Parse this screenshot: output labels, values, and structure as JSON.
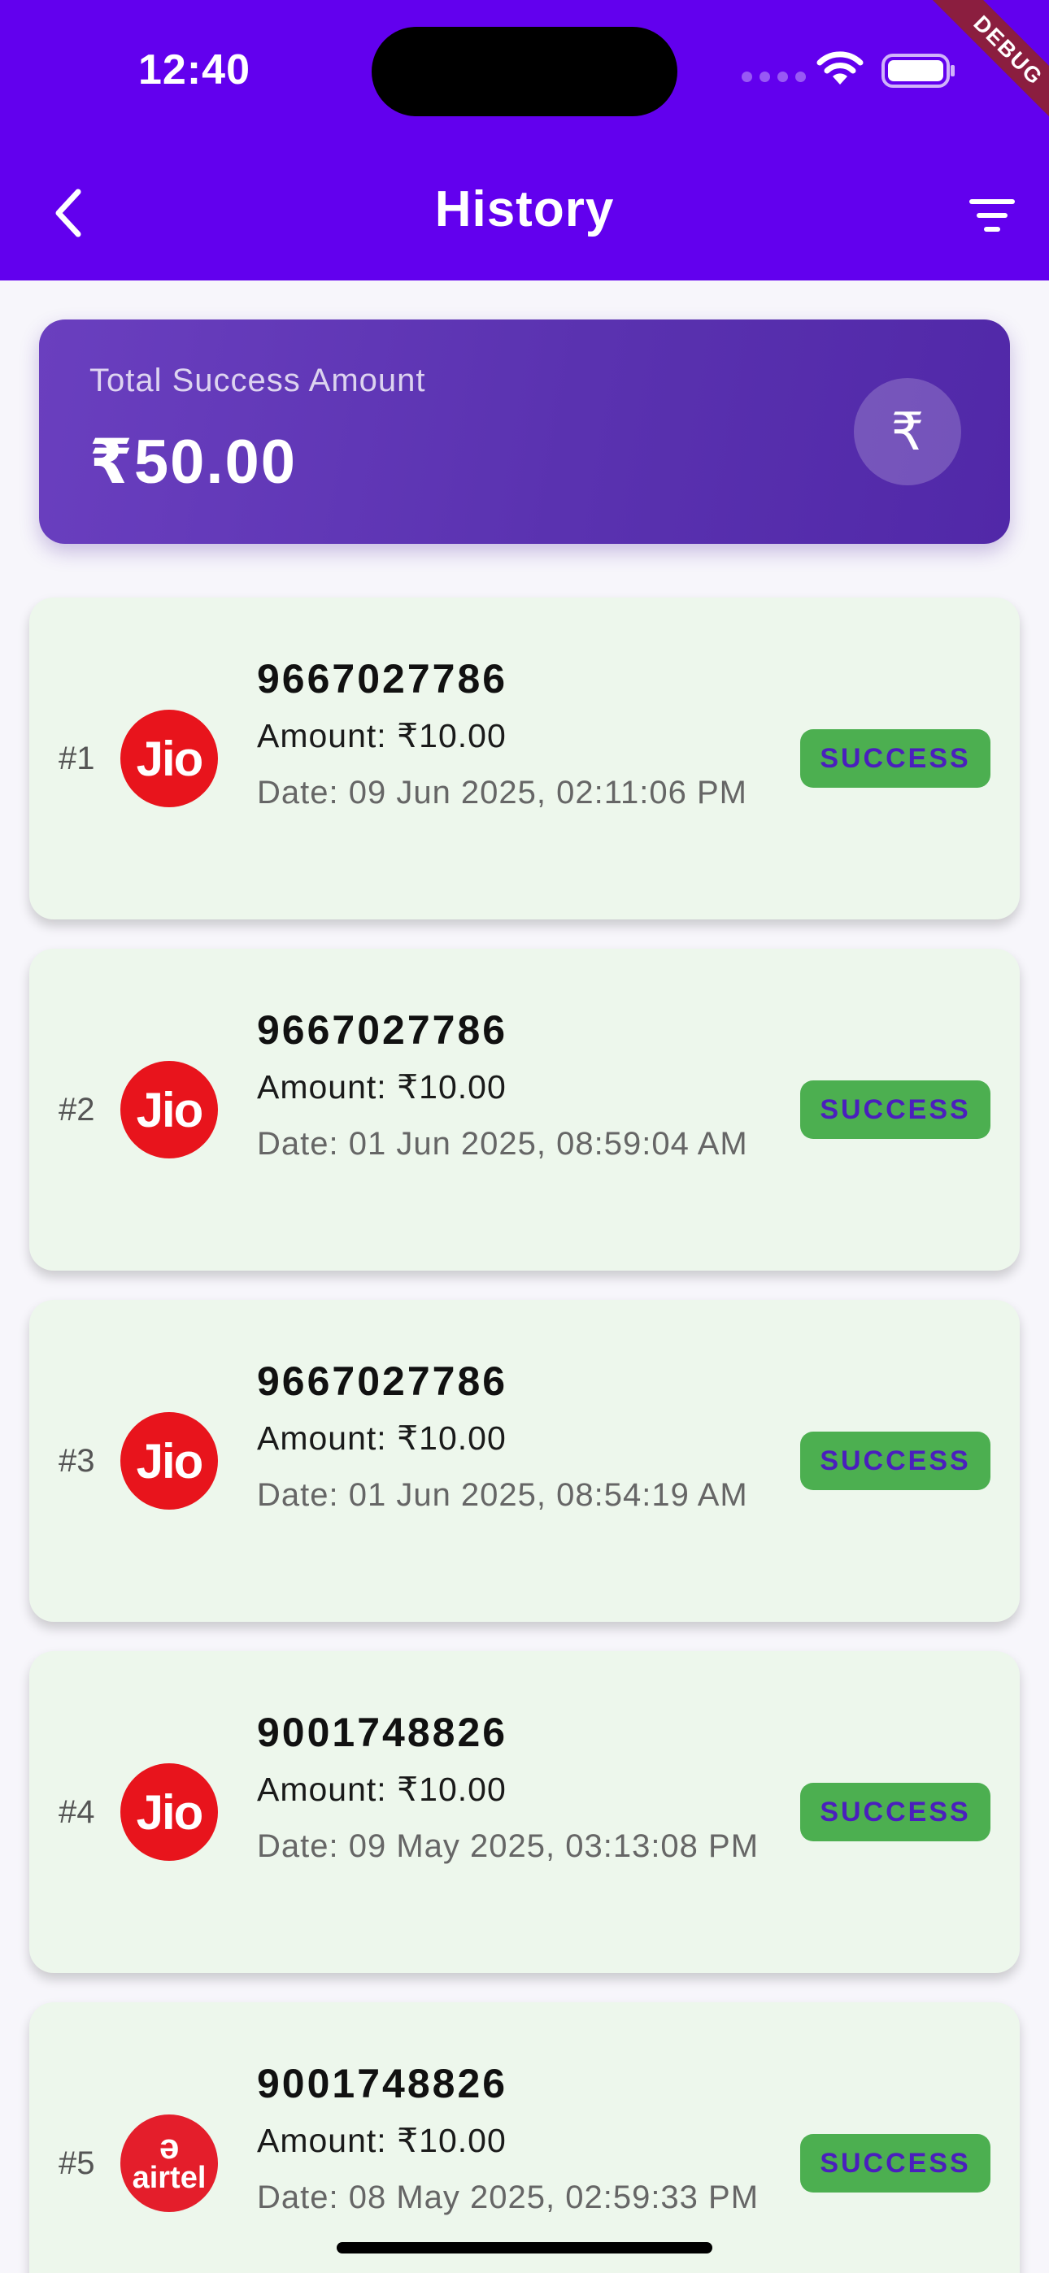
{
  "status_bar": {
    "time": "12:40",
    "debug_label": "DEBUG"
  },
  "header": {
    "title": "History",
    "back_icon": "chevron-left-icon",
    "filter_icon": "filter-icon"
  },
  "summary": {
    "label": "Total Success Amount",
    "amount": "₹50.00",
    "icon": "₹"
  },
  "transactions": [
    {
      "index": "#1",
      "operator": "jio",
      "logo_text": "Jio",
      "number": "9667027786",
      "amount": "Amount: ₹10.00",
      "date": "Date: 09 Jun 2025, 02:11:06 PM",
      "status": "SUCCESS"
    },
    {
      "index": "#2",
      "operator": "jio",
      "logo_text": "Jio",
      "number": "9667027786",
      "amount": "Amount: ₹10.00",
      "date": "Date: 01 Jun 2025, 08:59:04 AM",
      "status": "SUCCESS"
    },
    {
      "index": "#3",
      "operator": "jio",
      "logo_text": "Jio",
      "number": "9667027786",
      "amount": "Amount: ₹10.00",
      "date": "Date: 01 Jun 2025, 08:54:19 AM",
      "status": "SUCCESS"
    },
    {
      "index": "#4",
      "operator": "jio",
      "logo_text": "Jio",
      "number": "9001748826",
      "amount": "Amount: ₹10.00",
      "date": "Date: 09 May 2025, 03:13:08 PM",
      "status": "SUCCESS"
    },
    {
      "index": "#5",
      "operator": "airtel",
      "logo_text": "airtel",
      "number": "9001748826",
      "amount": "Amount: ₹10.00",
      "date": "Date: 08 May 2025, 02:59:33 PM",
      "status": "SUCCESS"
    }
  ],
  "colors": {
    "primary": "#6200EE",
    "success": "#4CAF50",
    "card_bg": "#EDF7EC",
    "jio_red": "#E8141C"
  }
}
